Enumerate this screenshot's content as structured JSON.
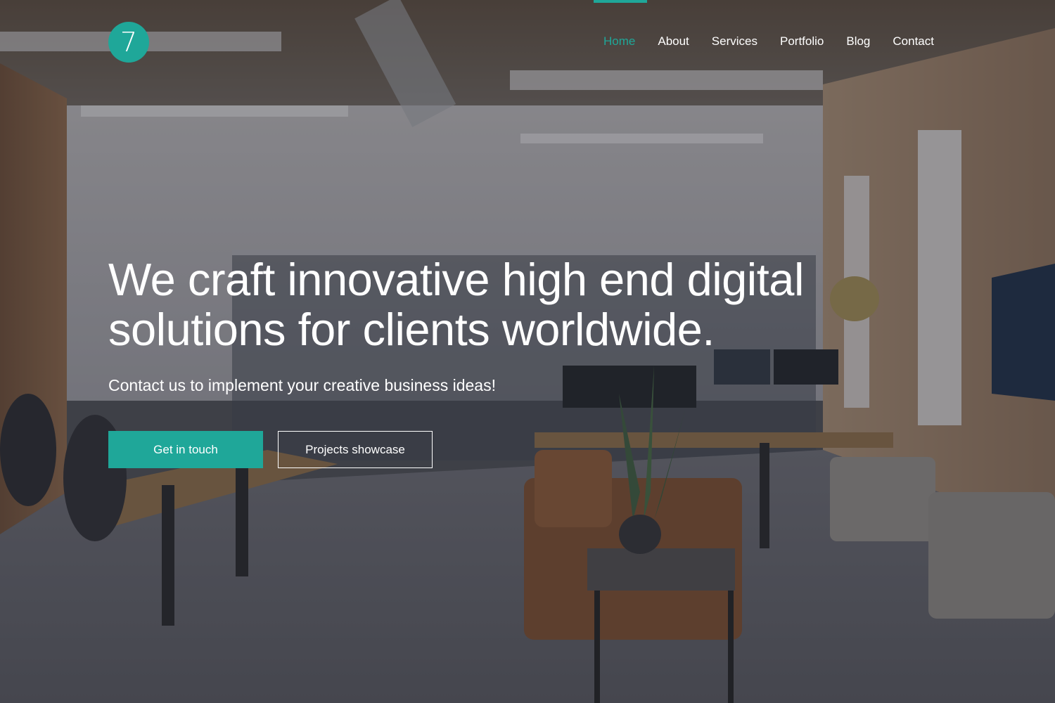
{
  "brand": {
    "logo_text": "7",
    "accent_color": "#1fa799"
  },
  "nav": {
    "items": [
      {
        "label": "Home",
        "active": true
      },
      {
        "label": "About",
        "active": false
      },
      {
        "label": "Services",
        "active": false
      },
      {
        "label": "Portfolio",
        "active": false
      },
      {
        "label": "Blog",
        "active": false
      },
      {
        "label": "Contact",
        "active": false
      }
    ],
    "active_color": "#1fa799"
  },
  "hero": {
    "headline_line1": "We craft innovative high end digital",
    "headline_line2": "solutions for clients worldwide.",
    "subheadline": "Contact us to implement your creative business ideas!",
    "primary_button": "Get in touch",
    "secondary_button": "Projects showcase",
    "background": "office-interior-photo"
  }
}
